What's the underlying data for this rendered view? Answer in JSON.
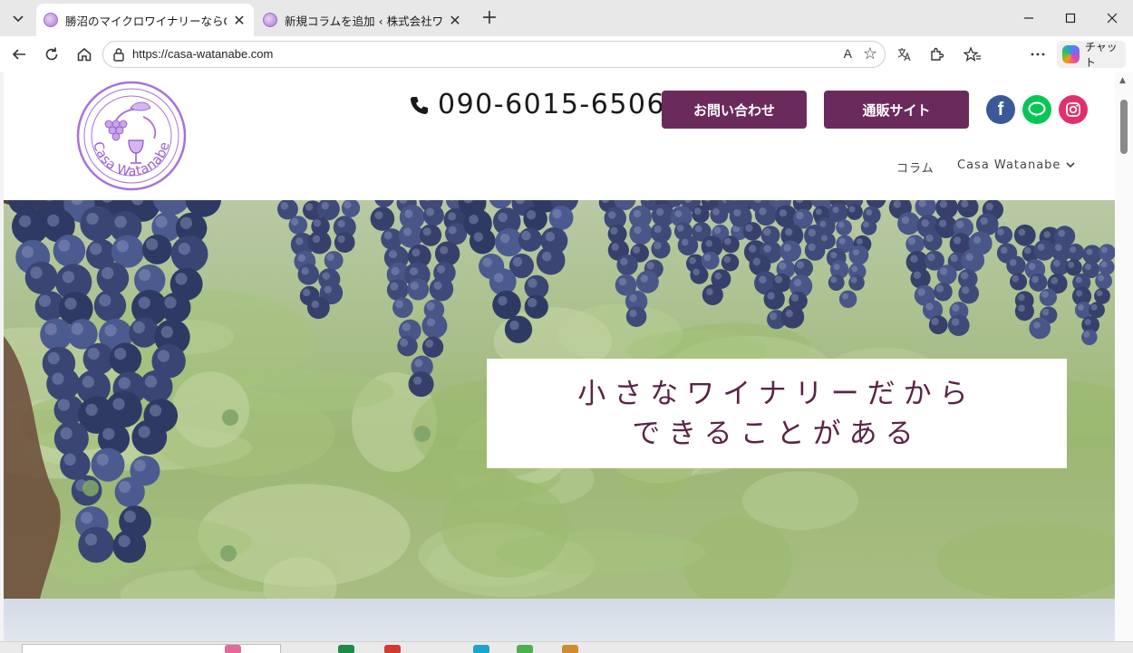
{
  "browser": {
    "tabs": [
      {
        "title": "勝沼のマイクロワイナリーならCasa Watanabe",
        "active": true
      },
      {
        "title": "新規コラムを追加 ‹ 株式会社ワイナリー",
        "active": false
      }
    ],
    "url": "https://casa-watanabe.com",
    "read_aloud_label": "A",
    "copilot_label": "チャット",
    "icons": [
      "tab-list-icon",
      "close-icon",
      "new-tab-icon",
      "minimize-icon",
      "maximize-icon",
      "back-icon",
      "refresh-icon",
      "home-icon",
      "lock-icon",
      "read-aloud-icon",
      "favorite-star-icon",
      "extensions-icon",
      "favorites-icon",
      "more-icon"
    ]
  },
  "site": {
    "logo_text": "Casa Watanabe",
    "phone": "090-6015-6506",
    "buttons": {
      "contact": "お問い合わせ",
      "shop": "通販サイト"
    },
    "social": {
      "facebook": "f",
      "line": "LINE",
      "instagram": "instagram"
    },
    "nav": [
      {
        "label": "コラム"
      },
      {
        "label": "Casa Watanabe"
      }
    ],
    "hero": {
      "line1": "小さなワイナリーだから",
      "line2": "できることがある"
    }
  },
  "colors": {
    "brand": "#6b2a5c",
    "hero_text": "#5a2446",
    "facebook": "#3b5998",
    "line": "#06c755",
    "instagram": "#e1306c",
    "logo_purple": "#a872d8"
  }
}
